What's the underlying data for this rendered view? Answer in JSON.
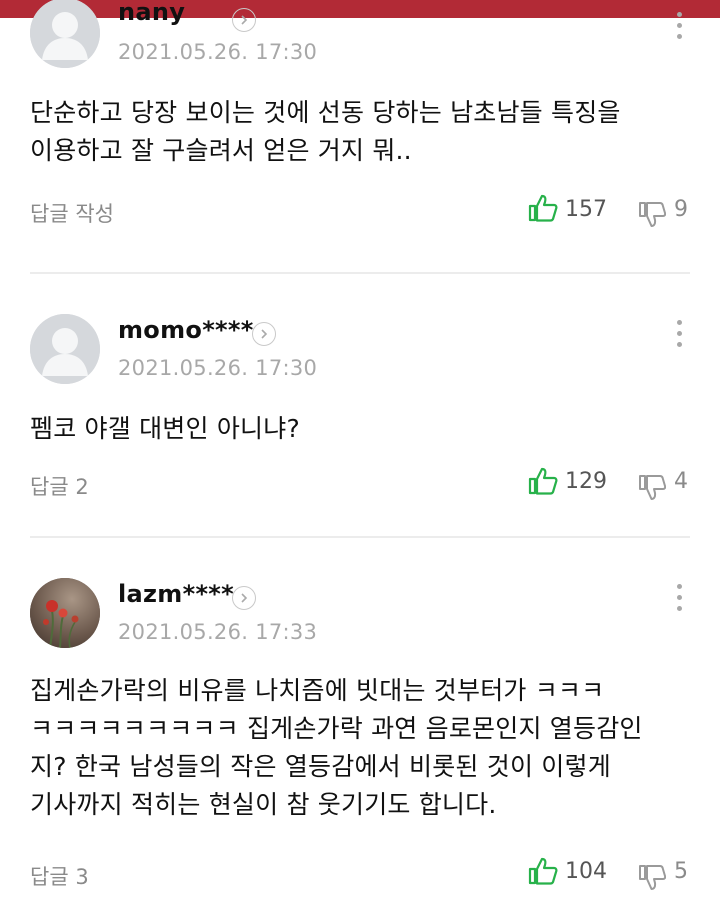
{
  "comments": [
    {
      "author": "nany",
      "time": "2021.05.26. 17:30",
      "text": "단순하고 당장 보이는 것에 선동 당하는 남초남들 특징을\n이용하고 잘 구슬려서 얻은 거지 뭐..",
      "reply": "답글 작성",
      "likes": "157",
      "dislikes": "9"
    },
    {
      "author": "momo****",
      "time": "2021.05.26. 17:30",
      "text": "펨코 야갤 대변인 아니냐?",
      "reply": "답글 2",
      "likes": "129",
      "dislikes": "4"
    },
    {
      "author": "lazm****",
      "time": "2021.05.26. 17:33",
      "text": "집게손가락의 비유를 나치즘에 빗대는 것부터가 ㅋㅋㅋ\nㅋㅋㅋㅋㅋㅋㅋㅋㅋ 집게손가락 과연 음로몬인지 열등감인\n지? 한국 남성들의 작은 열등감에서 비롯된 것이 이렇게\n기사까지 적히는 현실이 참 웃기기도 합니다.",
      "reply": "답글 3",
      "likes": "104",
      "dislikes": "5"
    }
  ],
  "colors": {
    "header_bar": "#b22a36",
    "like_icon": "#27b14a",
    "muted_text": "#a8a8a8"
  }
}
